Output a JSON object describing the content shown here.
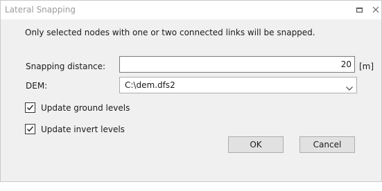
{
  "window": {
    "title": "Lateral Snapping",
    "restore_icon": "restore-icon",
    "close_icon": "close-icon"
  },
  "info_text": "Only selected nodes with one or two connected links will be snapped.",
  "form": {
    "snapping_distance_label": "Snapping distance:",
    "snapping_distance_value": "20",
    "snapping_distance_unit": "[m]",
    "dem_label": "DEM:",
    "dem_value": "C:\\dem.dfs2"
  },
  "options": {
    "update_ground_levels_label": "Update ground levels",
    "update_ground_levels_checked": true,
    "update_invert_levels_label": "Update invert levels",
    "update_invert_levels_checked": true
  },
  "buttons": {
    "ok_label": "OK",
    "cancel_label": "Cancel"
  }
}
